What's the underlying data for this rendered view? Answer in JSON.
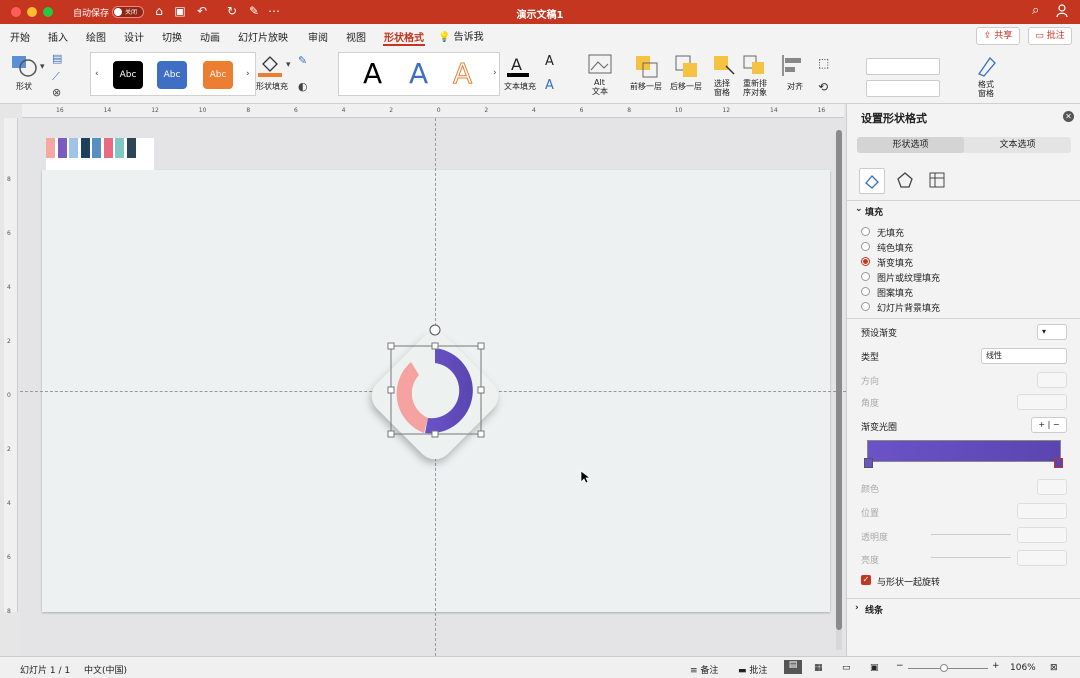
{
  "titlebar": {
    "autosave": "自动保存",
    "toggle": "关闭",
    "title": "演示文稿1"
  },
  "tabs": [
    "开始",
    "插入",
    "绘图",
    "设计",
    "切换",
    "动画",
    "幻灯片放映",
    "审阅",
    "视图",
    "形状格式"
  ],
  "tell": "告诉我",
  "share": "共享",
  "comments": "批注",
  "ribbon": {
    "shape": "形状",
    "shape_fill": "形状填充",
    "abc": "Abc",
    "bigA": "A",
    "text_fill": "文本填充",
    "alt1": "Alt",
    "alt2": "文本",
    "forward": "前移一层",
    "backward": "后移一层",
    "select1": "选择",
    "select2": "窗格",
    "reorder1": "重新排",
    "reorder2": "序对象",
    "align": "对齐",
    "fmt1": "格式",
    "fmt2": "窗格"
  },
  "colors": {
    "accent": "#c4361f",
    "swatches": [
      "#f4a9a3",
      "#7a5cc0",
      "#9fc4e8",
      "#1f3f5e",
      "#5a8fc4",
      "#e86a84",
      "#7ec8c8",
      "#2d4657"
    ]
  },
  "panel": {
    "title": "设置形状格式",
    "tab_shape": "形状选项",
    "tab_text": "文本选项",
    "fill": "填充",
    "options": [
      "无填充",
      "纯色填充",
      "渐变填充",
      "图片或纹理填充",
      "图案填充",
      "幻灯片背景填充"
    ],
    "selected": "渐变填充",
    "preset": "预设渐变",
    "type": "类型",
    "type_value": "线性",
    "direction": "方向",
    "angle": "角度",
    "stops": "渐变光圈",
    "color": "颜色",
    "position": "位置",
    "transparency": "透明度",
    "brightness": "亮度",
    "rotate": "与形状一起旋转",
    "line": "线条"
  },
  "status": {
    "slide": "幻灯片 1 / 1",
    "lang": "中文(中国)",
    "notes": "备注",
    "comments": "批注",
    "zoom": "106%"
  },
  "ruler_h": [
    "16",
    "14",
    "12",
    "10",
    "8",
    "6",
    "4",
    "2",
    "0",
    "2",
    "4",
    "6",
    "8",
    "10",
    "12",
    "14",
    "16"
  ],
  "ruler_v": [
    "8",
    "6",
    "4",
    "2",
    "0",
    "2",
    "4",
    "6",
    "8"
  ]
}
